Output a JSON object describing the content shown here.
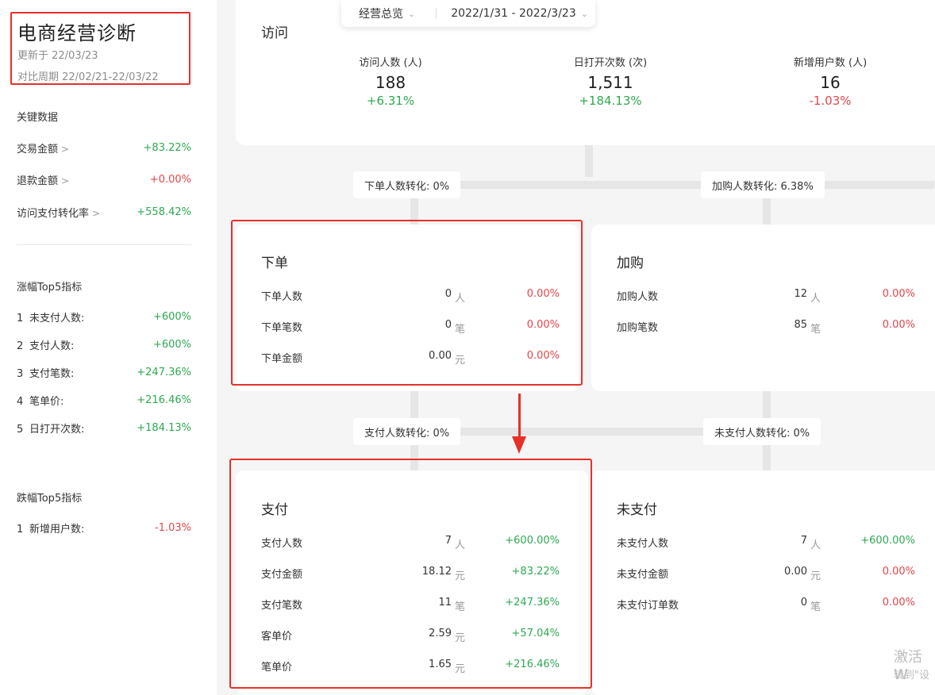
{
  "sidebar": {
    "title": "电商经营诊断",
    "updated": "更新于 22/03/23",
    "compare_period": "对比周期 22/02/21-22/03/22",
    "key_data": {
      "heading": "关键数据",
      "items": [
        {
          "label": "交易金额",
          "chevron": ">",
          "change": "+83.22%"
        },
        {
          "label": "退款金额",
          "chevron": ">",
          "change": "+0.00%"
        },
        {
          "label": "访问支付转化率",
          "chevron": ">",
          "change": "+558.42%"
        }
      ]
    },
    "top_rise": {
      "heading": "涨幅Top5指标",
      "items": [
        {
          "rank": "1",
          "label": "未支付人数:",
          "change": "+600%"
        },
        {
          "rank": "2",
          "label": "支付人数:",
          "change": "+600%"
        },
        {
          "rank": "3",
          "label": "支付笔数:",
          "change": "+247.36%"
        },
        {
          "rank": "4",
          "label": "笔单价:",
          "change": "+216.46%"
        },
        {
          "rank": "5",
          "label": "日打开次数:",
          "change": "+184.13%"
        }
      ]
    },
    "top_fall": {
      "heading": "跌幅Top5指标",
      "items": [
        {
          "rank": "1",
          "label": "新增用户数:",
          "change": "-1.03%"
        }
      ]
    }
  },
  "filter": {
    "view": "经营总览",
    "date_range": "2022/1/31 - 2022/3/23"
  },
  "visit": {
    "title": "访问",
    "stats": [
      {
        "label": "访问人数 (人)",
        "value": "188",
        "change": "+6.31%"
      },
      {
        "label": "日打开次数 (次)",
        "value": "1,511",
        "change": "+184.13%"
      },
      {
        "label": "新增用户数 (人)",
        "value": "16",
        "change": "-1.03%"
      }
    ]
  },
  "conversions": {
    "order": "下单人数转化: 0%",
    "cart": "加购人数转化: 6.38%",
    "pay": "支付人数转化: 0%",
    "unpaid": "未支付人数转化: 0%"
  },
  "order_card": {
    "title": "下单",
    "rows": [
      {
        "label": "下单人数",
        "value": "0",
        "unit": "人",
        "change": "0.00%"
      },
      {
        "label": "下单笔数",
        "value": "0",
        "unit": "笔",
        "change": "0.00%"
      },
      {
        "label": "下单金额",
        "value": "0.00",
        "unit": "元",
        "change": "0.00%"
      }
    ]
  },
  "cart_card": {
    "title": "加购",
    "rows": [
      {
        "label": "加购人数",
        "value": "12",
        "unit": "人",
        "change": "0.00%"
      },
      {
        "label": "加购笔数",
        "value": "85",
        "unit": "笔",
        "change": "0.00%"
      }
    ]
  },
  "pay_card": {
    "title": "支付",
    "rows": [
      {
        "label": "支付人数",
        "value": "7",
        "unit": "人",
        "change": "+600.00%"
      },
      {
        "label": "支付金额",
        "value": "18.12",
        "unit": "元",
        "change": "+83.22%"
      },
      {
        "label": "支付笔数",
        "value": "11",
        "unit": "笔",
        "change": "+247.36%"
      },
      {
        "label": "客单价",
        "value": "2.59",
        "unit": "元",
        "change": "+57.04%"
      },
      {
        "label": "笔单价",
        "value": "1.65",
        "unit": "元",
        "change": "+216.46%"
      }
    ]
  },
  "unpaid_card": {
    "title": "未支付",
    "rows": [
      {
        "label": "未支付人数",
        "value": "7",
        "unit": "人",
        "change": "+600.00%"
      },
      {
        "label": "未支付金额",
        "value": "0.00",
        "unit": "元",
        "change": "0.00%"
      },
      {
        "label": "未支付订单数",
        "value": "0",
        "unit": "笔",
        "change": "0.00%"
      }
    ]
  },
  "watermark": {
    "line1": "激活 W",
    "line2": "转到\"设"
  },
  "colors": {
    "positive": "#2da951",
    "negative": "#e6454a",
    "highlight": "#e8302a"
  }
}
